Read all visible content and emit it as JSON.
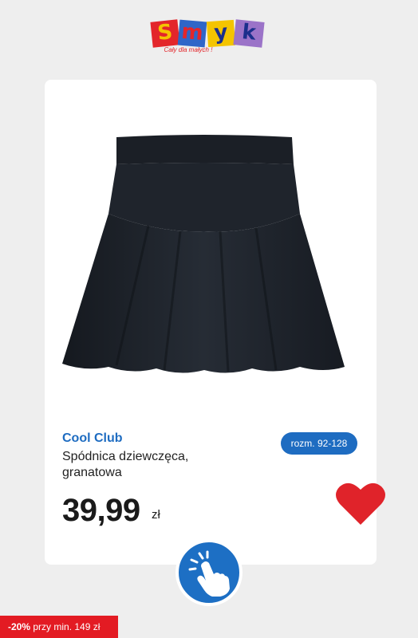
{
  "logo": {
    "letters": [
      "S",
      "m",
      "y",
      "k"
    ],
    "tagline": "Cały dla małych !"
  },
  "product": {
    "brand": "Cool Club",
    "name": "Spódnica dziewczęca, granatowa",
    "size_label": "rozm. 92-128",
    "price": "39,99",
    "currency": "zł",
    "image_icon": "navy-skirt-image"
  },
  "favorite": {
    "icon": "heart-icon",
    "color": "#e0232a"
  },
  "tap_button": {
    "icon": "tap-hand-icon",
    "color": "#1d6fc4"
  },
  "promo": {
    "discount": "-20%",
    "text": " przy min. 149 zł",
    "color": "#e31b23"
  },
  "colors": {
    "accent": "#1e6cc1",
    "background": "#eeeeee",
    "card": "#ffffff"
  }
}
